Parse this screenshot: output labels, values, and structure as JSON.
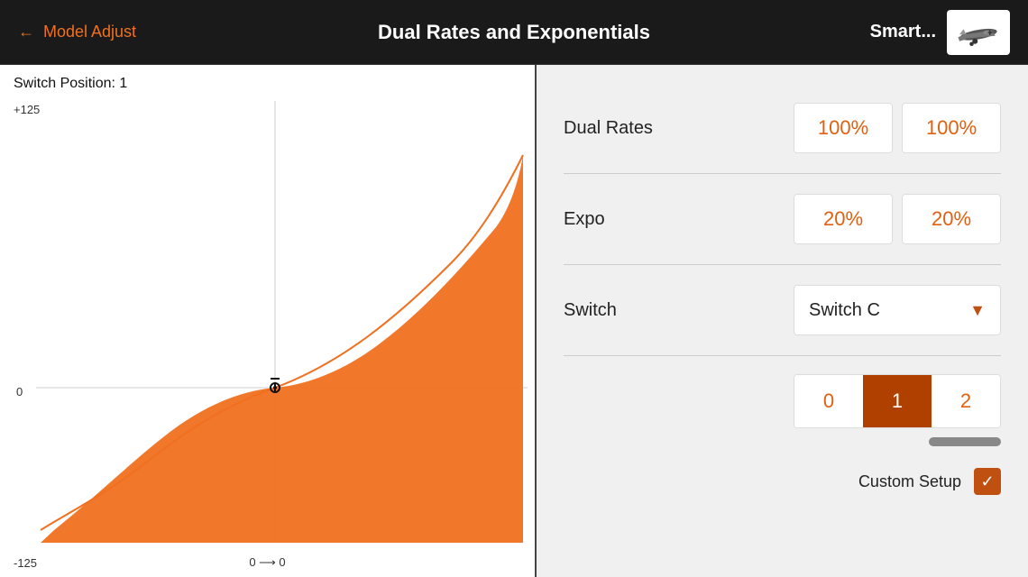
{
  "header": {
    "back_label": "← Model Adjust",
    "title": "Dual Rates and Exponentials",
    "model_name": "Smart...",
    "back_arrow": "←"
  },
  "graph": {
    "switch_position_label": "Switch Position: 1",
    "y_top": "+125",
    "y_mid": "0",
    "y_bottom": "-125",
    "x_label": "0 ⟶ 0"
  },
  "controls": {
    "dual_rates_label": "Dual Rates",
    "dual_rates_value1": "100%",
    "dual_rates_value2": "100%",
    "expo_label": "Expo",
    "expo_value1": "20%",
    "expo_value2": "20%",
    "switch_label": "Switch",
    "switch_value": "Switch C",
    "switch_positions": [
      "0",
      "1",
      "2"
    ],
    "active_position": 1,
    "custom_setup_label": "Custom Setup",
    "dropdown_arrow": "▼"
  }
}
